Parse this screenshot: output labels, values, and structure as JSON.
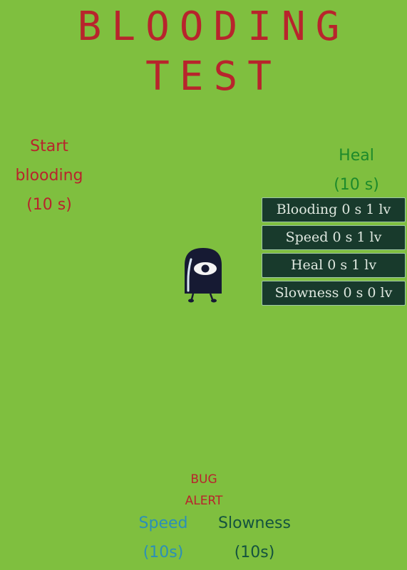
{
  "title": {
    "line1": "BLOODING",
    "line2": "TEST"
  },
  "buttons": {
    "start": [
      "Start",
      "blooding",
      "(10 s)"
    ],
    "heal": [
      "Heal",
      "(10 s)"
    ],
    "speed": [
      "Speed",
      "(10s)"
    ],
    "slowness": [
      "Slowness",
      "(10s)"
    ]
  },
  "bug_alert": [
    "BUG",
    "ALERT"
  ],
  "status_effects": [
    "Blooding 0 s 1 lv",
    "Speed 0 s 1 lv",
    "Heal 0 s 1 lv",
    "Slowness 0 s  0 lv"
  ],
  "colors": {
    "background": "#7fbf3f",
    "title": "#b8242c",
    "start": "#b8242c",
    "heal": "#1d8a2b",
    "speed": "#2b8fb8",
    "slowness": "#14533e",
    "panel": "#183a2c"
  },
  "player": {
    "icon": "eye-ghost-icon"
  }
}
